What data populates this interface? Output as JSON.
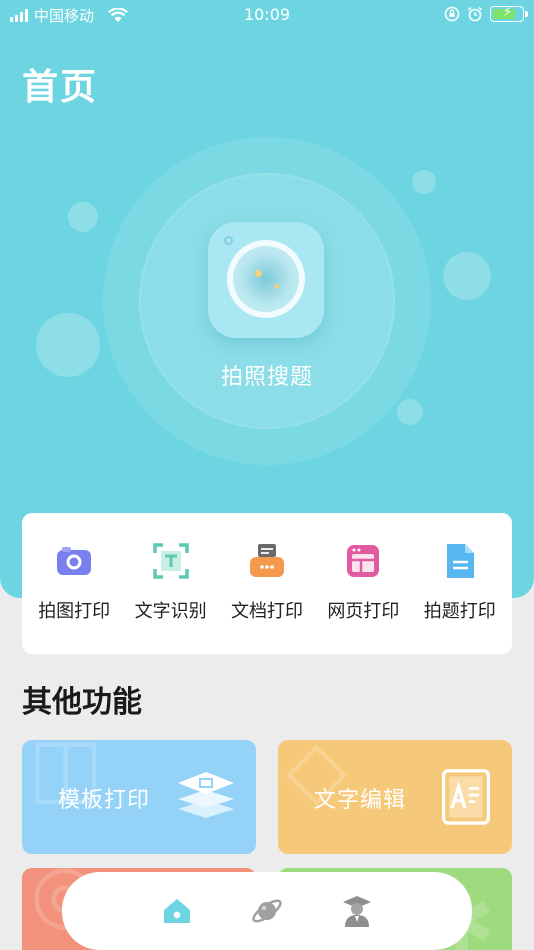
{
  "status_bar": {
    "carrier": "中国移动",
    "time": "10:09"
  },
  "header": {
    "title": "首页"
  },
  "hero": {
    "camera_label": "拍照搜题",
    "camera_icon": "camera-lens-icon"
  },
  "quick_actions": [
    {
      "label": "拍图打印",
      "icon": "camera-icon",
      "color": "#7a7ff0"
    },
    {
      "label": "文字识别",
      "icon": "scan-text-icon",
      "color": "#5cc9b2"
    },
    {
      "label": "文档打印",
      "icon": "printer-icon",
      "color": "#f39a4d"
    },
    {
      "label": "网页打印",
      "icon": "webpage-icon",
      "color": "#e15ba0"
    },
    {
      "label": "拍题打印",
      "icon": "document-icon",
      "color": "#55b6f0"
    }
  ],
  "other": {
    "title": "其他功能",
    "cards": [
      {
        "label": "模板打印",
        "icon": "stack-layers-icon",
        "bg": "#95d2f8"
      },
      {
        "label": "文字编辑",
        "icon": "text-edit-icon",
        "bg": "#f6c97a"
      },
      {
        "label": "",
        "icon": "",
        "bg": "#f2917c"
      },
      {
        "label": "",
        "icon": "",
        "bg": "#9edb7e"
      }
    ]
  },
  "tab_bar": {
    "items": [
      {
        "icon": "home-icon",
        "active": true,
        "color": "#6dd5e1"
      },
      {
        "icon": "planet-icon",
        "active": false,
        "color": "#9a9a9a"
      },
      {
        "icon": "student-icon",
        "active": false,
        "color": "#9a9a9a"
      }
    ]
  }
}
